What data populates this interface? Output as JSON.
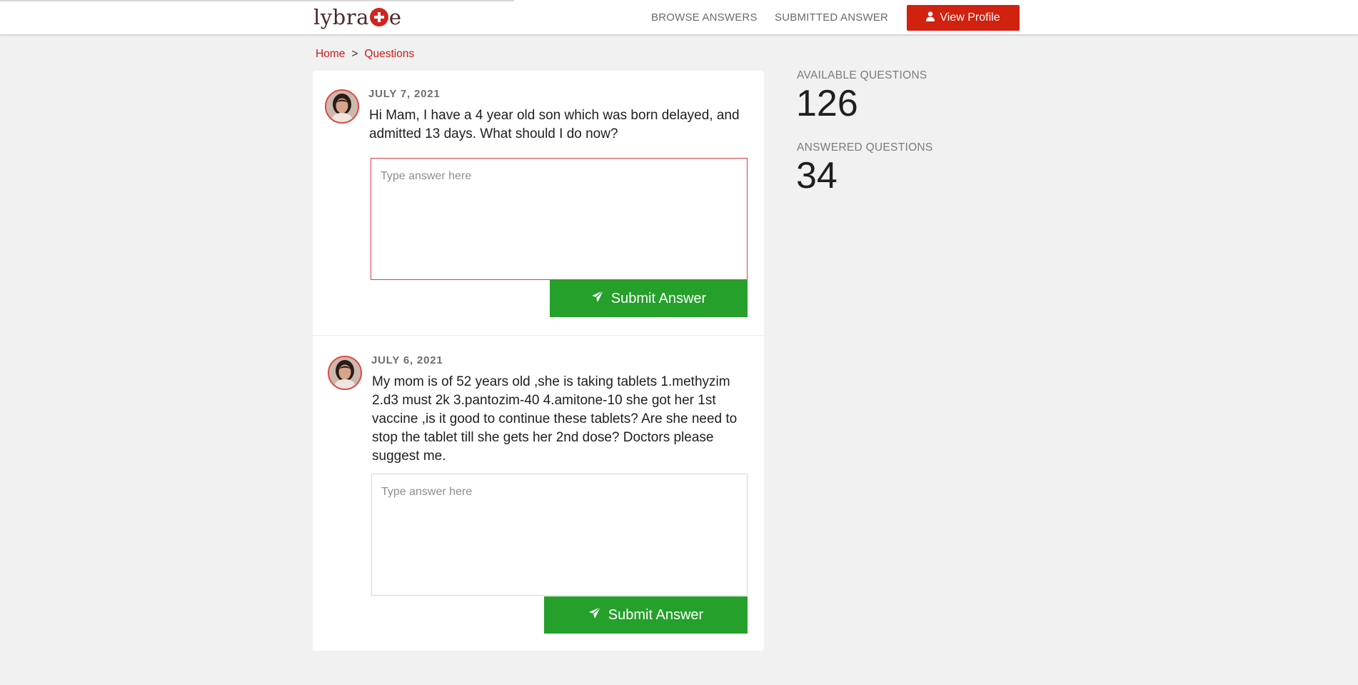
{
  "header": {
    "logo_left": "lybra",
    "logo_right": "e",
    "nav": [
      {
        "label": "BROWSE ANSWERS"
      },
      {
        "label": "SUBMITTED ANSWER"
      }
    ],
    "profile_button": "View Profile",
    "brand_color": "#d1210f"
  },
  "breadcrumb": {
    "home": "Home",
    "separator": ">",
    "current": "Questions"
  },
  "questions": [
    {
      "date": "JULY 7, 2021",
      "text": "Hi Mam, I have a 4 year old son which was born delayed, and admitted 13 days. What should I do now?",
      "answer_value": "",
      "answer_placeholder": "Type answer here",
      "submit_label": "Submit Answer"
    },
    {
      "date": "JULY 6, 2021",
      "text": "My mom is of 52 years old ,she is taking tablets 1.methyzim 2.d3 must 2k 3.pantozim-40 4.amitone-10 she got her 1st vaccine ,is it good to continue these tablets? Are she need to stop the tablet till she gets her 2nd dose? Doctors please suggest me.",
      "answer_value": "",
      "answer_placeholder": "Type answer here",
      "submit_label": "Submit Answer"
    }
  ],
  "stats": {
    "available_label": "AVAILABLE QUESTIONS",
    "available_value": "126",
    "answered_label": "ANSWERED QUESTIONS",
    "answered_value": "34"
  },
  "colors": {
    "submit_green": "#24a02b",
    "link_red": "#c91c1c",
    "background": "#f1f1f1"
  },
  "icons": {
    "profile": "user-icon",
    "submit": "send-icon"
  }
}
